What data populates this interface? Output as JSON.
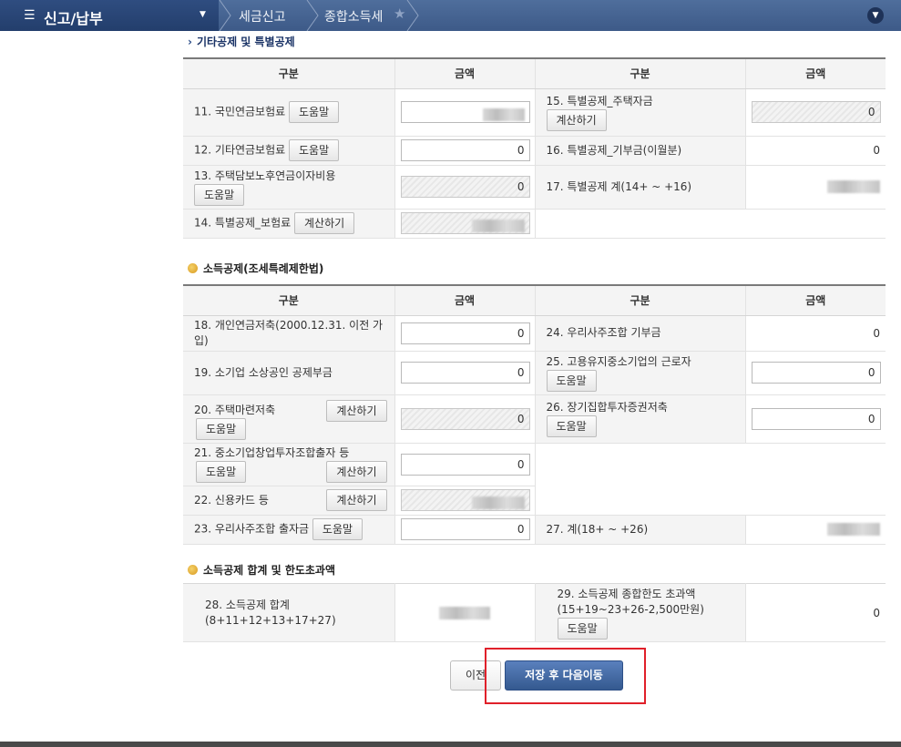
{
  "topbar": {
    "menu_title": "신고/납부",
    "breadcrumb": [
      "세금신고",
      "종합소득세"
    ],
    "icons": [
      "menu-icon",
      "chevron-down-icon",
      "star-icon",
      "circle-chevron-down-icon"
    ]
  },
  "section1": {
    "title": "기타공제 및 특별공제",
    "headers": [
      "구분",
      "금액",
      "구분",
      "금액"
    ],
    "rows": {
      "r11": {
        "label": "11. 국민연금보험료",
        "button": "도움말"
      },
      "r12": {
        "label": "12. 기타연금보험료",
        "button": "도움말",
        "value": "0"
      },
      "r13": {
        "label": "13. 주택담보노후연금이자비용",
        "button": "도움말",
        "value": "0"
      },
      "r14": {
        "label": "14. 특별공제_보험료",
        "button": "계산하기"
      },
      "r15": {
        "label": "15. 특별공제_주택자금",
        "button": "계산하기",
        "value": "0"
      },
      "r16": {
        "label": "16. 특별공제_기부금(이월분)",
        "value": "0"
      },
      "r17": {
        "label": "17. 특별공제 계(14+ ~ +16)"
      }
    }
  },
  "section2": {
    "title": "소득공제(조세특례제한법)",
    "headers": [
      "구분",
      "금액",
      "구분",
      "금액"
    ],
    "rows": {
      "r18": {
        "label": "18. 개인연금저축(2000.12.31. 이전 가입)",
        "value": "0"
      },
      "r19": {
        "label": "19. 소기업 소상공인 공제부금",
        "value": "0"
      },
      "r20": {
        "label": "20. 주택마련저축",
        "button_calc": "계산하기",
        "button_help": "도움말",
        "value": "0"
      },
      "r21": {
        "label": "21. 중소기업창업투자조합출자 등",
        "button_help": "도움말",
        "button_calc": "계산하기",
        "value": "0"
      },
      "r22": {
        "label": "22. 신용카드 등",
        "button_calc": "계산하기"
      },
      "r23": {
        "label": "23. 우리사주조합 출자금",
        "button_help": "도움말",
        "value": "0"
      },
      "r24": {
        "label": "24. 우리사주조합 기부금",
        "value": "0"
      },
      "r25": {
        "label": "25. 고용유지중소기업의 근로자",
        "button_help": "도움말",
        "value": "0"
      },
      "r26": {
        "label": "26. 장기집합투자증권저축",
        "button_help": "도움말",
        "value": "0"
      },
      "r27": {
        "label": "27. 계(18+ ~ +26)"
      }
    }
  },
  "section3": {
    "title": "소득공제 합계 및 한도초과액",
    "rows": {
      "r28": {
        "label": "28. 소득공제 합계(8+11+12+13+17+27)"
      },
      "r29": {
        "label": "29. 소득공제 종합한도 초과액(15+19~23+26-2,500만원)",
        "button_help": "도움말",
        "value": "0"
      }
    }
  },
  "actions": {
    "prev_label": "이전",
    "next_label": "저장 후 다음이동"
  }
}
